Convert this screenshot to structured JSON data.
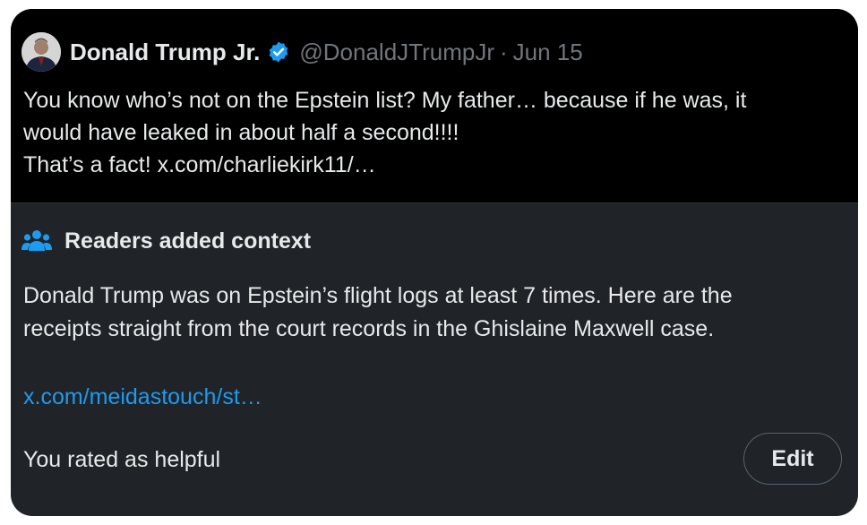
{
  "tweet": {
    "author_name": "Donald Trump Jr.",
    "handle": "@DonaldJTrumpJr",
    "separator": "·",
    "date": "Jun 15",
    "text_lines": [
      "You know who’s not on the Epstein list? My father… because if he was, it",
      "would have leaked in about half a second!!!!",
      "That’s a fact! x.com/charliekirk11/…"
    ],
    "avatar_icon": "avatar",
    "verified_icon": "verified-badge-icon",
    "verified_color": "#1d9bf0"
  },
  "community_note": {
    "icon": "people-icon",
    "title": "Readers added context",
    "text_lines": [
      "Donald Trump was on Epstein’s flight logs at least 7 times. Here are the",
      "receipts straight from the court records in the Ghislaine Maxwell case."
    ],
    "link": "x.com/meidastouch/st…",
    "link_color": "#1d9bf0",
    "rating_status": "You rated as helpful",
    "edit_label": "Edit"
  },
  "colors": {
    "tweet_bg": "#000000",
    "note_bg": "#202327",
    "text": "#e7e9ea",
    "muted": "#71767b"
  }
}
